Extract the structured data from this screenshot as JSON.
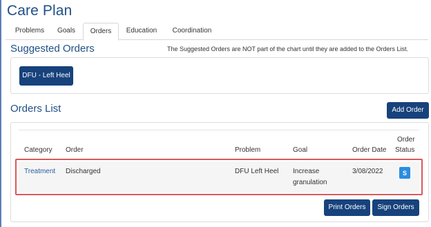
{
  "app": {
    "title": "Care Plan"
  },
  "tabs": [
    {
      "label": "Problems"
    },
    {
      "label": "Goals"
    },
    {
      "label": "Orders"
    },
    {
      "label": "Education"
    },
    {
      "label": "Coordination"
    }
  ],
  "active_tab": "Orders",
  "suggested_orders": {
    "title": "Suggested Orders",
    "notice": "The Suggested Orders are NOT part of the chart until they are added to the Orders List.",
    "items": [
      {
        "label": "DFU - Left Heel"
      }
    ]
  },
  "orders_list": {
    "title": "Orders List",
    "add_button": "Add Order",
    "columns": {
      "category": "Category",
      "order": "Order",
      "problem": "Problem",
      "goal": "Goal",
      "order_date": "Order Date",
      "order_status_line1": "Order",
      "order_status_line2": "Status"
    },
    "rows": [
      {
        "category": "Treatment",
        "order": "Discharged",
        "problem": "DFU Left Heel",
        "goal_line1": "Increase",
        "goal_line2": "granulation",
        "order_date": "3/08/2022",
        "status": "S"
      }
    ],
    "print_button": "Print Orders",
    "sign_button": "Sign Orders"
  },
  "colors": {
    "title_blue": "#1f4f86",
    "button_navy": "#17427c",
    "status_badge": "#2a8de0",
    "highlight_red": "#d9595c"
  }
}
